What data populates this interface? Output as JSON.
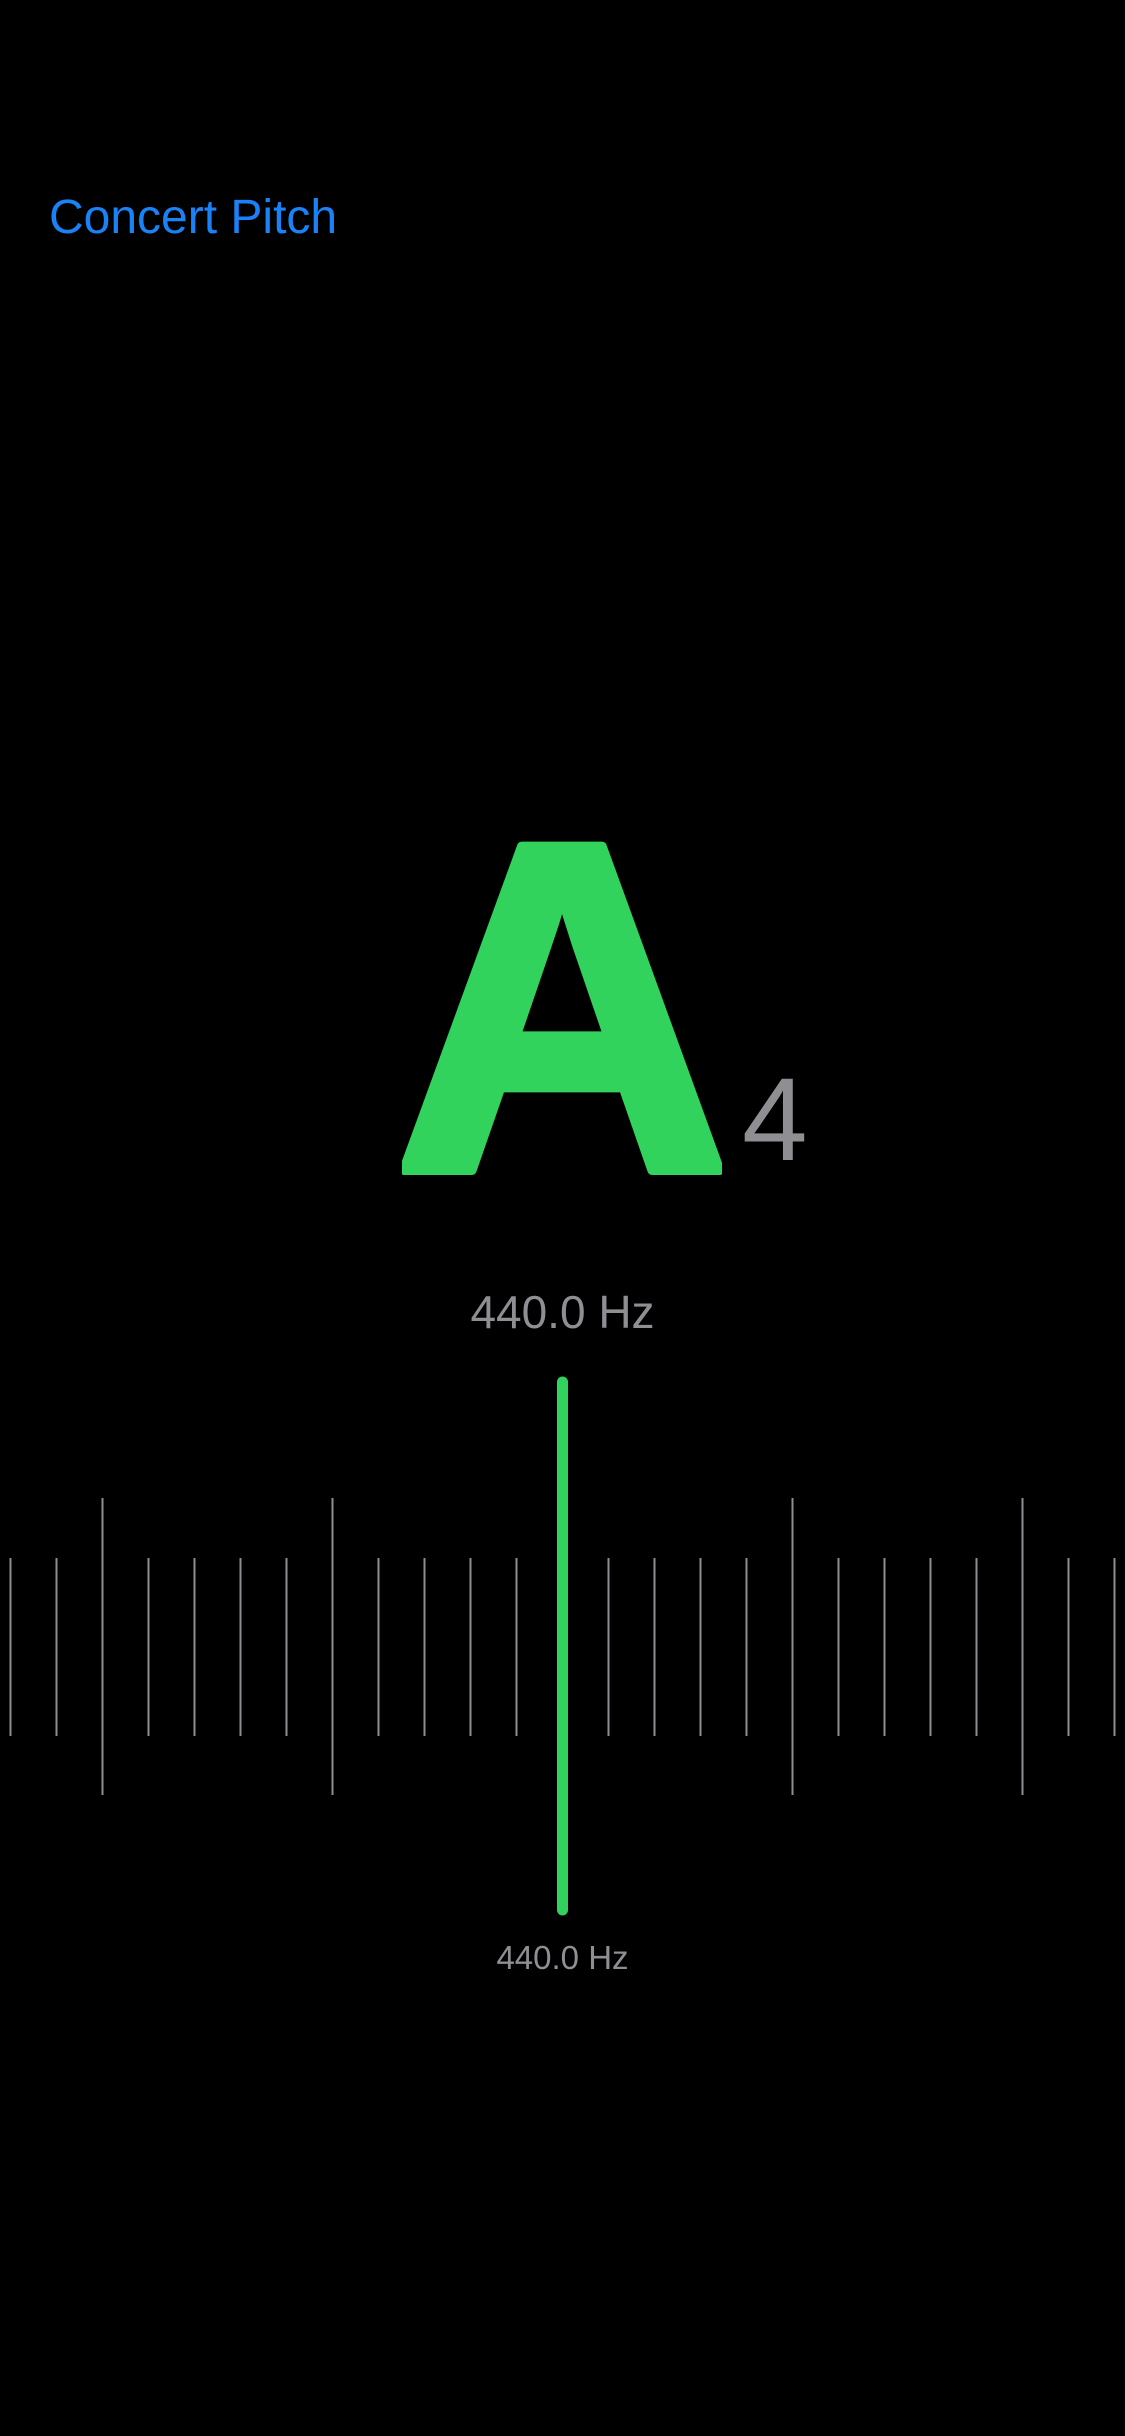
{
  "header": {
    "concert_pitch_label": "Concert Pitch"
  },
  "tuner": {
    "note": "A",
    "octave": "4",
    "detected_frequency": "440.0 Hz",
    "reference_frequency": "440.0 Hz",
    "cents_offset": 0,
    "in_tune_color": "#32d35c",
    "label_color": "#8e8e93",
    "accent_color": "#1a82f7"
  }
}
